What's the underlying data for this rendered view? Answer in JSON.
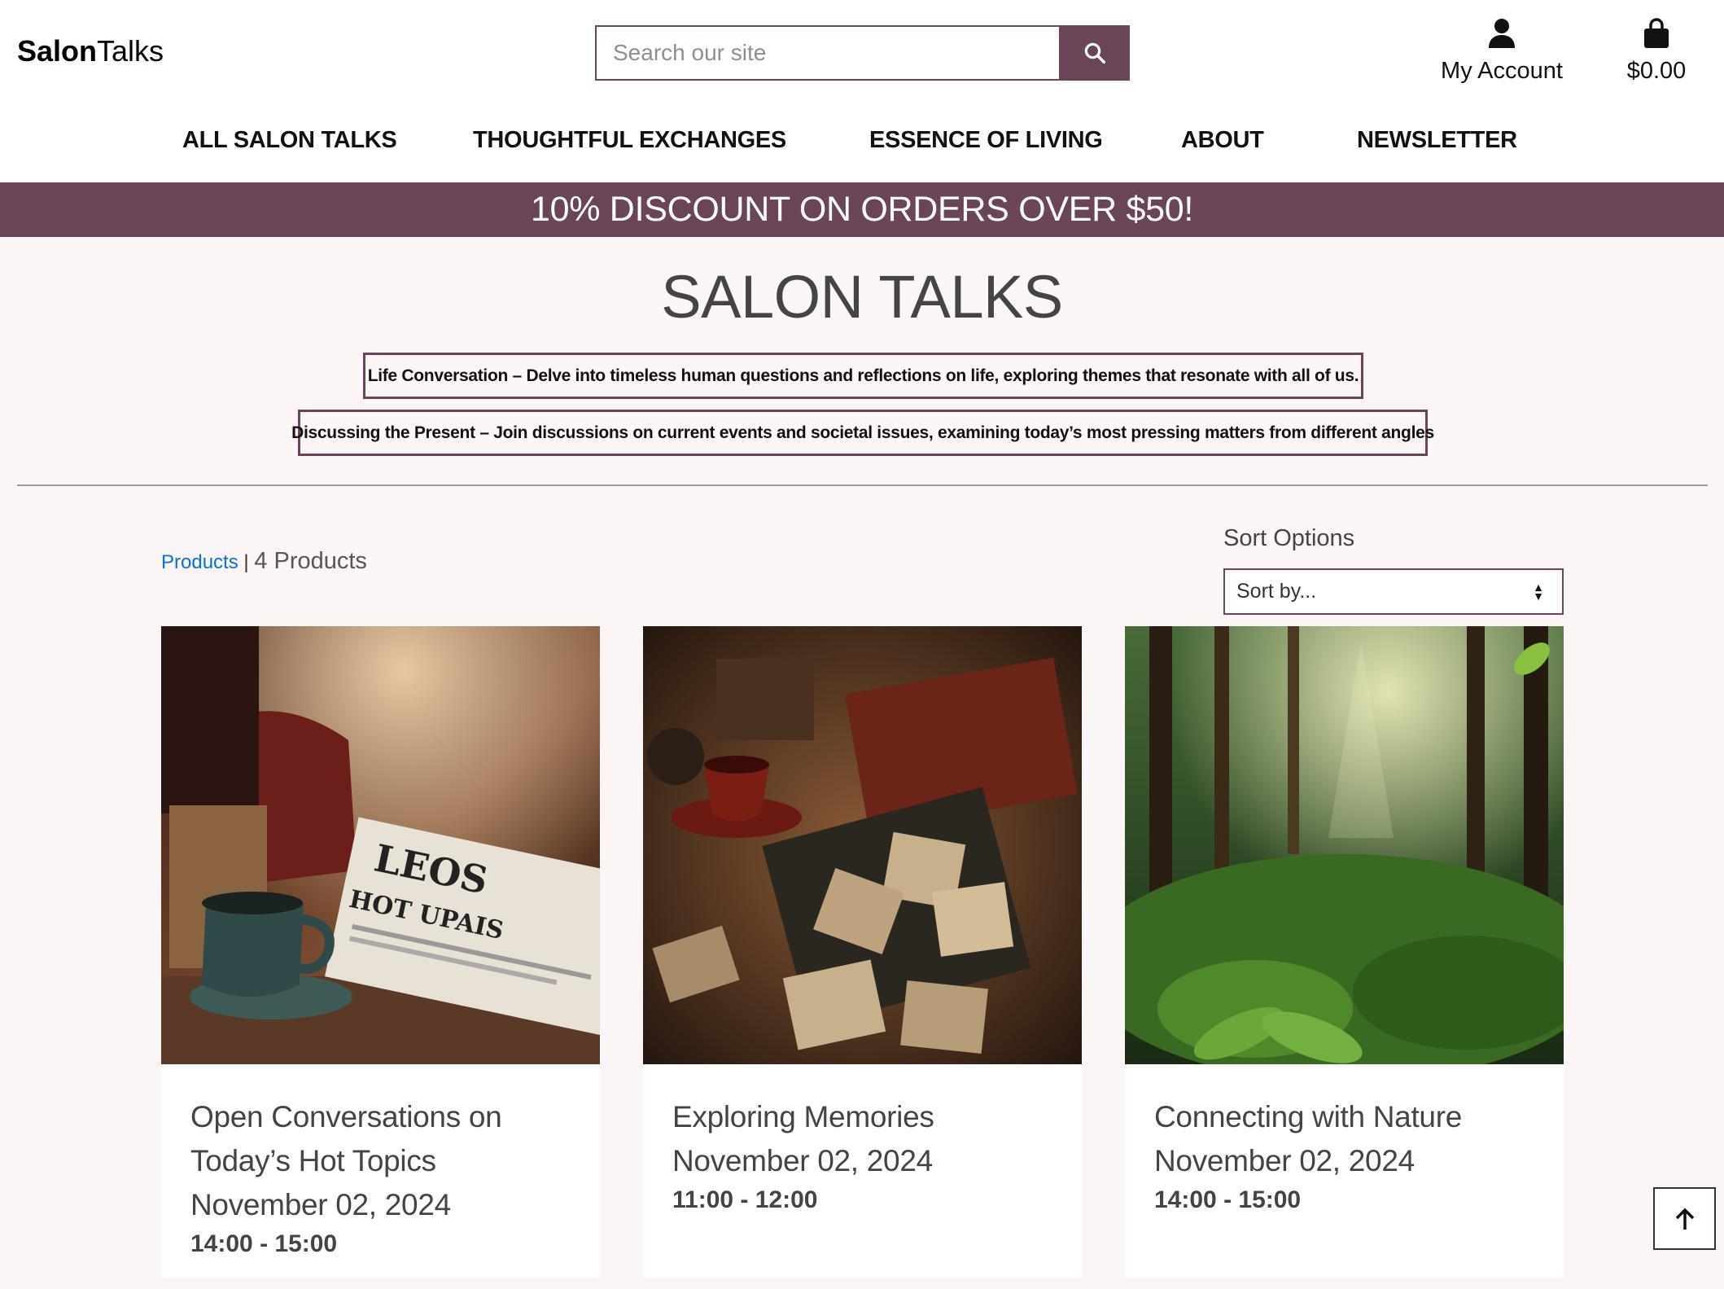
{
  "logo": {
    "bold": "Salon",
    "regular": "Talks"
  },
  "search": {
    "placeholder": "Search our site"
  },
  "account": {
    "label": "My Account"
  },
  "cart": {
    "total": "$0.00"
  },
  "nav": [
    {
      "label": "ALL SALON TALKS"
    },
    {
      "label": "THOUGHTFUL EXCHANGES"
    },
    {
      "label": "ESSENCE OF LIVING"
    },
    {
      "label": "ABOUT"
    },
    {
      "label": "NEWSLETTER"
    }
  ],
  "promo": {
    "text": "10% DISCOUNT ON ORDERS OVER $50!"
  },
  "page": {
    "title": "SALON TALKS"
  },
  "categories": [
    {
      "label": "Life Conversation – Delve into timeless human questions and reflections on life, exploring themes that resonate with all of us."
    },
    {
      "label": "Discussing the Present – Join discussions on current events and societal issues, examining today’s most pressing matters from different angles"
    }
  ],
  "breadcrumb": {
    "link": "Products",
    "separator": "|",
    "count": "4 Products"
  },
  "sort": {
    "label": "Sort Options",
    "selected": "Sort by..."
  },
  "products": [
    {
      "name": "Open Conversations on Today’s Hot Topics",
      "date": "November 02, 2024",
      "time": "14:00 - 15:00"
    },
    {
      "name": "Exploring Memories",
      "date": "November 02, 2024",
      "time": "11:00 - 12:00"
    },
    {
      "name": "Connecting with Nature",
      "date": "November 02, 2024",
      "time": "14:00 - 15:00"
    }
  ],
  "colors": {
    "brand": "#6a4558",
    "background": "#fcf5f5",
    "link": "#0a6fe0"
  },
  "icons": {
    "search": "search-icon",
    "account": "user-icon",
    "cart": "shopping-bag-icon",
    "back_to_top": "arrow-up-icon"
  }
}
